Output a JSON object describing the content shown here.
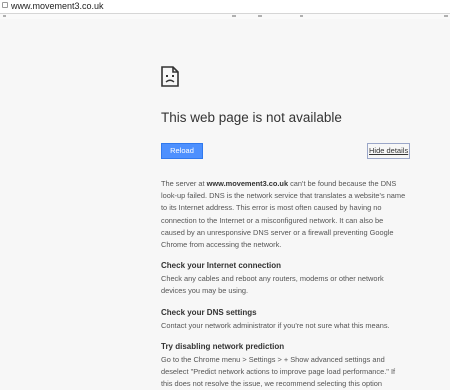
{
  "browser": {
    "url": "www.movement3.co.uk"
  },
  "error": {
    "title": "This web page is not available",
    "reload_label": "Reload",
    "hide_details_label": "Hide details",
    "description_prefix": "The server at ",
    "description_host": "www.movement3.co.uk",
    "description_suffix": " can't be found because the DNS look-up failed. DNS is the network service that translates a website's name to its Internet address. This error is most often caused by having no connection to the Internet or a misconfigured network. It can also be caused by an unresponsive DNS server or a firewall preventing Google Chrome from accessing the network."
  },
  "sections": [
    {
      "heading": "Check your Internet connection",
      "text": "Check any cables and reboot any routers, modems or other network devices you may be using."
    },
    {
      "heading": "Check your DNS settings",
      "text": "Contact your network administrator if you're not sure what this means."
    },
    {
      "heading": "Try disabling network prediction",
      "text": "Go to the Chrome menu > Settings > + Show advanced settings and deselect \"Predict network actions to improve page load performance.\" If this does not resolve the issue, we recommend selecting this option"
    }
  ],
  "icons": {
    "page_icon": "sad-page-icon",
    "lock_icon": "page-info-icon"
  },
  "colors": {
    "accent": "#4d90fe",
    "background": "#f7f7f7"
  }
}
